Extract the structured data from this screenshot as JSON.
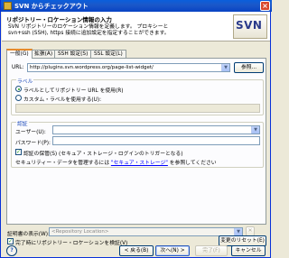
{
  "window": {
    "title": "SVN からチェックアウト",
    "close_label": "×"
  },
  "header": {
    "title": "リポジトリー・ロケーション情報の入力",
    "description_line1": "SVN リポジトリーのロケーション情報を定義します。 プロキシーと",
    "description_line2": "svn+ssh (SSH), https 接続に追加設定を指定することができます。",
    "logo_text": "SVN"
  },
  "tabs": [
    {
      "label": "一般(G)",
      "active": true
    },
    {
      "label": "拡張(A)",
      "active": false
    },
    {
      "label": "SSH 設定(S)",
      "active": false
    },
    {
      "label": "SSL 設定(L)",
      "active": false
    }
  ],
  "url": {
    "label": "URL:",
    "value": "http://plugins.svn.wordpress.org/page-list-widget/",
    "browse_label": "参照..."
  },
  "label_group": {
    "title": "ラベル",
    "option_url": "ラベルとしてリポジトリー URL を使用(R)",
    "option_custom": "カスタム・ラベルを使用する(U):",
    "selected": "url"
  },
  "auth_group": {
    "title": "認証",
    "user_label": "ユーザー(U):",
    "user_value": "",
    "password_label": "パスワード(P):",
    "password_value": "",
    "save_password_label": "認証の保管(S) (セキュア・ストレージ・ログインのトリガーとなる)",
    "save_password_checked": true,
    "secure_storage_prefix": "セキュリティー・データを管理するには ",
    "secure_storage_link": "\"セキュア・ストレージ\"",
    "secure_storage_suffix": " を参照してください"
  },
  "bottom": {
    "location_label": "証明書の表示(W):",
    "location_placeholder": "<Repository Location>",
    "validate_label": "完了時にリポジトリー・ロケーションを検証(V)",
    "validate_checked": true,
    "reset_label": "変更のリセット(E)"
  },
  "buttons": {
    "help": "?",
    "back": "< 戻る(B)",
    "next": "次へ(N) >",
    "finish": "完了(F)",
    "cancel": "キャンセル"
  },
  "colors": {
    "title_bar": "#0a5fdc",
    "link": "#0000ff",
    "tab_highlight": "#e68b2c"
  }
}
